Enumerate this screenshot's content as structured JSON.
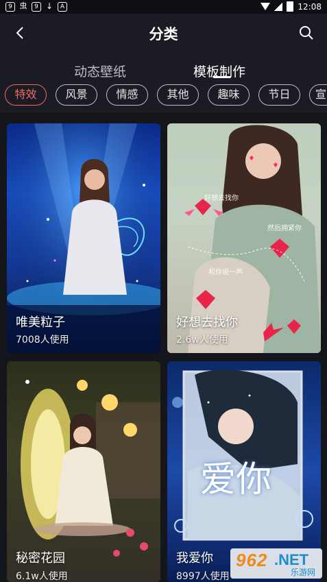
{
  "status_bar": {
    "time": "12:08",
    "left_icons": [
      "9",
      "虫",
      "9",
      "↓",
      "A"
    ]
  },
  "header": {
    "title": "分类"
  },
  "sub_tabs": [
    {
      "label": "动态壁纸",
      "active": false
    },
    {
      "label": "模板制作",
      "active": true
    }
  ],
  "chips": [
    {
      "label": "特效",
      "active": true
    },
    {
      "label": "风景",
      "active": false
    },
    {
      "label": "情感",
      "active": false
    },
    {
      "label": "其他",
      "active": false
    },
    {
      "label": "趣味",
      "active": false
    },
    {
      "label": "节日",
      "active": false
    },
    {
      "label": "宣",
      "active": false
    }
  ],
  "cards": [
    {
      "title": "唯美粒子",
      "usage": "7008人使用"
    },
    {
      "title": "好想去找你",
      "usage": "2.6w人使用",
      "overlay_texts": [
        "好想去找你",
        "然后拥紧你",
        "和你说一声"
      ]
    },
    {
      "title": "秘密花园",
      "usage": "6.1w人使用"
    },
    {
      "title": "我爱你",
      "usage": "8997人使用",
      "overlay_text": "爱你"
    }
  ],
  "watermark": {
    "brand": "962",
    "tld": ".NET",
    "name": "乐游网"
  },
  "colors": {
    "accent": "#ef6a6a",
    "background": "#15161c",
    "bar": "#1b1c23"
  }
}
